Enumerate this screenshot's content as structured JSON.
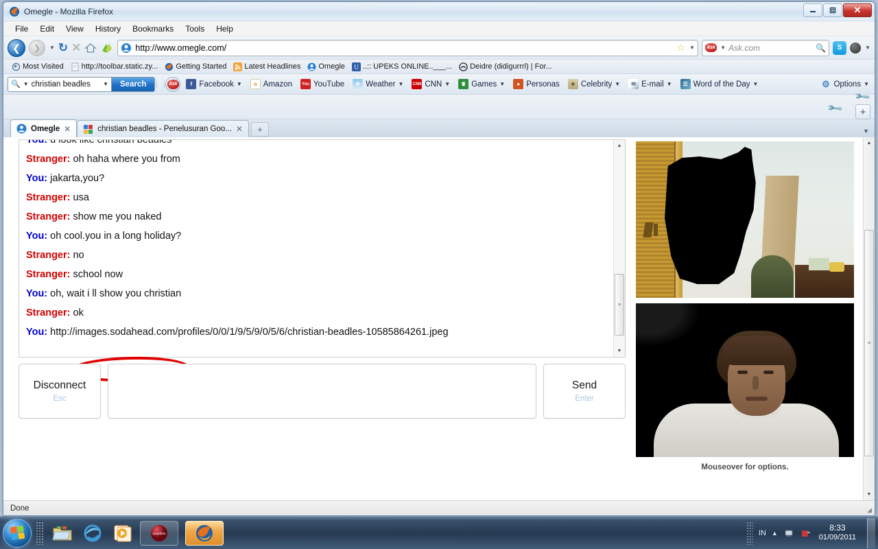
{
  "window": {
    "title": "Omegle - Mozilla Firefox",
    "minimize_label": "–",
    "maximize_label": "❐",
    "close_label": "✕"
  },
  "menubar": [
    {
      "label": "File"
    },
    {
      "label": "Edit"
    },
    {
      "label": "View"
    },
    {
      "label": "History"
    },
    {
      "label": "Bookmarks"
    },
    {
      "label": "Tools"
    },
    {
      "label": "Help"
    }
  ],
  "navbar": {
    "back_icon": "back-arrow-icon",
    "forward_icon": "forward-arrow-icon",
    "reload_label": "↻",
    "stop_label": "✕",
    "home_label": "⌂",
    "url": "http://www.omegle.com/",
    "star_label": "☆",
    "search_placeholder": "Ask.com",
    "search_provider": "Ask"
  },
  "bookmarks": [
    {
      "label": "Most Visited",
      "icon": "most-visited-icon"
    },
    {
      "label": "http://toolbar.static.zy...",
      "icon": "page-icon"
    },
    {
      "label": "Getting Started",
      "icon": "firefox-icon"
    },
    {
      "label": "Latest Headlines",
      "icon": "rss-icon"
    },
    {
      "label": "Omegle",
      "icon": "omegle-icon"
    },
    {
      "label": "..:: UPEKS ONLINE..___...",
      "icon": "upeks-icon"
    },
    {
      "label": "Deidre (didigurrrl) | For...",
      "icon": "deidre-icon"
    }
  ],
  "ask_toolbar": {
    "query_value": "christian beadles",
    "search_button": "Search",
    "items": [
      {
        "label": "Facebook",
        "icon": "facebook-icon",
        "caret": true
      },
      {
        "label": "Amazon",
        "icon": "amazon-icon",
        "caret": false
      },
      {
        "label": "YouTube",
        "icon": "youtube-icon",
        "caret": false
      },
      {
        "label": "Weather",
        "icon": "weather-icon",
        "caret": true
      },
      {
        "label": "CNN",
        "icon": "cnn-icon",
        "caret": true
      },
      {
        "label": "Games",
        "icon": "games-icon",
        "caret": true
      },
      {
        "label": "Personas",
        "icon": "personas-icon",
        "caret": false
      },
      {
        "label": "Celebrity",
        "icon": "celebrity-icon",
        "caret": true
      },
      {
        "label": "E-mail",
        "icon": "email-icon",
        "caret": true
      },
      {
        "label": "Word of the Day",
        "icon": "word-of-the-day-icon",
        "caret": true
      }
    ],
    "options_label": "Options"
  },
  "tabs": [
    {
      "label": "Omegle",
      "icon": "omegle-icon",
      "active": true,
      "close": "✕"
    },
    {
      "label": "christian beadles - Penelusuran Goo...",
      "icon": "google-icon",
      "active": false,
      "close": "✕"
    }
  ],
  "new_tab_label": "+",
  "omegle": {
    "chat": [
      {
        "speaker": "You:",
        "text": "u look like christian beadles",
        "side": "you",
        "clipped": true
      },
      {
        "speaker": "Stranger:",
        "text": "oh haha where you from",
        "side": "stranger"
      },
      {
        "speaker": "You:",
        "text": "jakarta,you?",
        "side": "you"
      },
      {
        "speaker": "Stranger:",
        "text": "usa",
        "side": "stranger"
      },
      {
        "speaker": "Stranger:",
        "text": "show me you naked",
        "side": "stranger",
        "circled": true
      },
      {
        "speaker": "You:",
        "text": "oh cool.you in a long holiday?",
        "side": "you"
      },
      {
        "speaker": "Stranger:",
        "text": "no",
        "side": "stranger"
      },
      {
        "speaker": "Stranger:",
        "text": "school now",
        "side": "stranger"
      },
      {
        "speaker": "You:",
        "text": "oh, wait i ll show you christian",
        "side": "you"
      },
      {
        "speaker": "Stranger:",
        "text": "ok",
        "side": "stranger"
      },
      {
        "speaker": "You:",
        "text": "http://images.sodahead.com/profiles/0/0/1/9/5/9/0/5/6/christian-beadles-10585864261.jpeg",
        "side": "you"
      }
    ],
    "disconnect_label": "Disconnect",
    "disconnect_key": "Esc",
    "send_label": "Send",
    "send_key": "Enter",
    "message_placeholder": "",
    "video_caption": "Mouseover for options.",
    "annotation_color": "#e00000"
  },
  "statusbar": {
    "text": "Done"
  },
  "taskbar": {
    "start_label": "start-orb-icon",
    "quick_launch": [
      {
        "name": "windows-explorer-icon"
      },
      {
        "name": "internet-explorer-icon"
      },
      {
        "name": "windows-media-player-icon"
      }
    ],
    "buttons": [
      {
        "name": "smartfren-taskbar-button",
        "label": "smartfren",
        "active": false
      },
      {
        "name": "firefox-taskbar-button",
        "label": "Firefox",
        "active": true
      }
    ],
    "tray": {
      "language": "IN",
      "show_hidden": "▲",
      "icons": [
        "network-icon",
        "usb-modem-icon"
      ],
      "time": "8:33",
      "date": "01/09/2011"
    }
  }
}
